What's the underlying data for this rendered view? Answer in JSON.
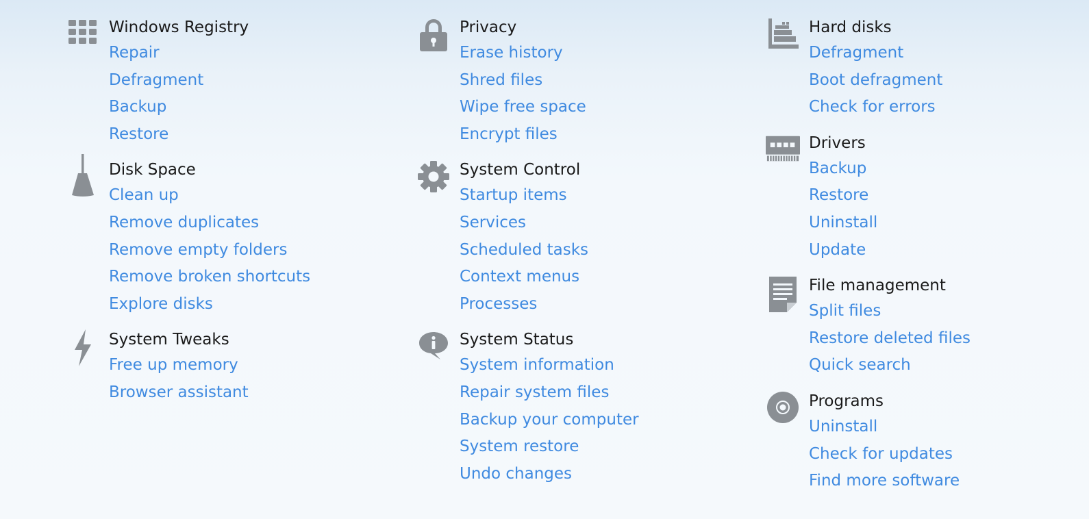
{
  "colors": {
    "link": "#3f8ae0",
    "title": "#1a1a1a",
    "icon": "#8a8f94"
  },
  "columns": [
    {
      "sections": [
        {
          "title": "Windows Registry",
          "icon": "grid-icon",
          "links": [
            "Repair",
            "Defragment",
            "Backup",
            "Restore"
          ]
        },
        {
          "title": "Disk Space",
          "icon": "broom-icon",
          "links": [
            "Clean up",
            "Remove duplicates",
            "Remove empty folders",
            "Remove broken shortcuts",
            "Explore disks"
          ]
        },
        {
          "title": "System Tweaks",
          "icon": "lightning-icon",
          "links": [
            "Free up memory",
            "Browser assistant"
          ]
        }
      ]
    },
    {
      "sections": [
        {
          "title": "Privacy",
          "icon": "lock-icon",
          "links": [
            "Erase history",
            "Shred files",
            "Wipe free space",
            "Encrypt files"
          ]
        },
        {
          "title": "System Control",
          "icon": "gear-icon",
          "links": [
            "Startup items",
            "Services",
            "Scheduled tasks",
            "Context menus",
            "Processes"
          ]
        },
        {
          "title": "System Status",
          "icon": "info-bubble-icon",
          "links": [
            "System information",
            "Repair system files",
            "Backup your computer",
            "System restore",
            "Undo changes"
          ]
        }
      ]
    },
    {
      "sections": [
        {
          "title": "Hard disks",
          "icon": "hard-disk-icon",
          "links": [
            "Defragment",
            "Boot defragment",
            "Check for errors"
          ]
        },
        {
          "title": "Drivers",
          "icon": "memory-chip-icon",
          "links": [
            "Backup",
            "Restore",
            "Uninstall",
            "Update"
          ]
        },
        {
          "title": "File management",
          "icon": "document-icon",
          "links": [
            "Split files",
            "Restore deleted files",
            "Quick search"
          ]
        },
        {
          "title": "Programs",
          "icon": "disc-icon",
          "links": [
            "Uninstall",
            "Check for updates",
            "Find more software"
          ]
        }
      ]
    }
  ]
}
